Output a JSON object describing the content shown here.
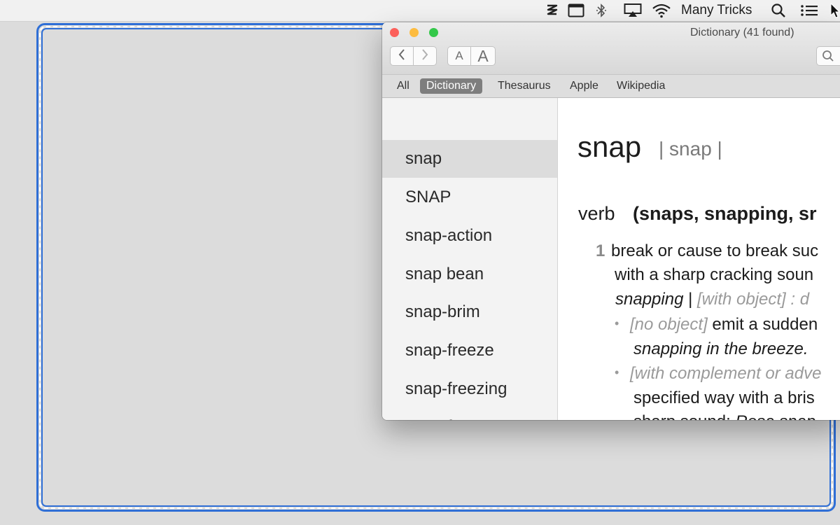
{
  "menubar": {
    "username": "Many Tricks",
    "icons": [
      "buffer-icon",
      "window-icon",
      "bluetooth-icon",
      "airplay-icon",
      "wifi-icon",
      "spotlight-search-icon",
      "notification-center-icon"
    ]
  },
  "window": {
    "title": "Dictionary (41 found)",
    "font_smaller_label": "A",
    "font_larger_label": "A",
    "tabs": [
      {
        "label": "All"
      },
      {
        "label": "Dictionary"
      },
      {
        "label": "Thesaurus"
      },
      {
        "label": "Apple"
      },
      {
        "label": "Wikipedia"
      }
    ],
    "selected_tab": "Dictionary"
  },
  "sidebar": {
    "items": [
      {
        "label": "snap"
      },
      {
        "label": "SNAP"
      },
      {
        "label": "snap-action"
      },
      {
        "label": "snap bean"
      },
      {
        "label": "snap-brim"
      },
      {
        "label": "snap-freeze"
      },
      {
        "label": "snap-freezing"
      },
      {
        "label": "snap-froze"
      }
    ],
    "selected": "snap"
  },
  "entry": {
    "headword": "snap",
    "pronunciation": "| snap |",
    "part_of_speech": "verb",
    "forms": "(snaps, snapping, sr",
    "sense_number": "1",
    "line1": "break or cause to break suc",
    "line2": "with a sharp cracking soun",
    "line3_italic": "snapping",
    "line3_sep": " | ",
    "line3_gray": "[with object] : d",
    "line4_gray": "[no object]",
    "line4_text": " emit a sudden",
    "line5_italic": "snapping in the breeze.",
    "line6_gray": "[with complement or adve",
    "line7": "specified way with a bris",
    "line8_text": "sharp sound: ",
    "line8_italic": "Rosa snap"
  },
  "colors": {
    "selection_frame": "#2f6fd6",
    "close": "#fc605b",
    "minimize": "#fdbc40",
    "zoom": "#34c84a",
    "active_tab": "#7e7e7e"
  }
}
